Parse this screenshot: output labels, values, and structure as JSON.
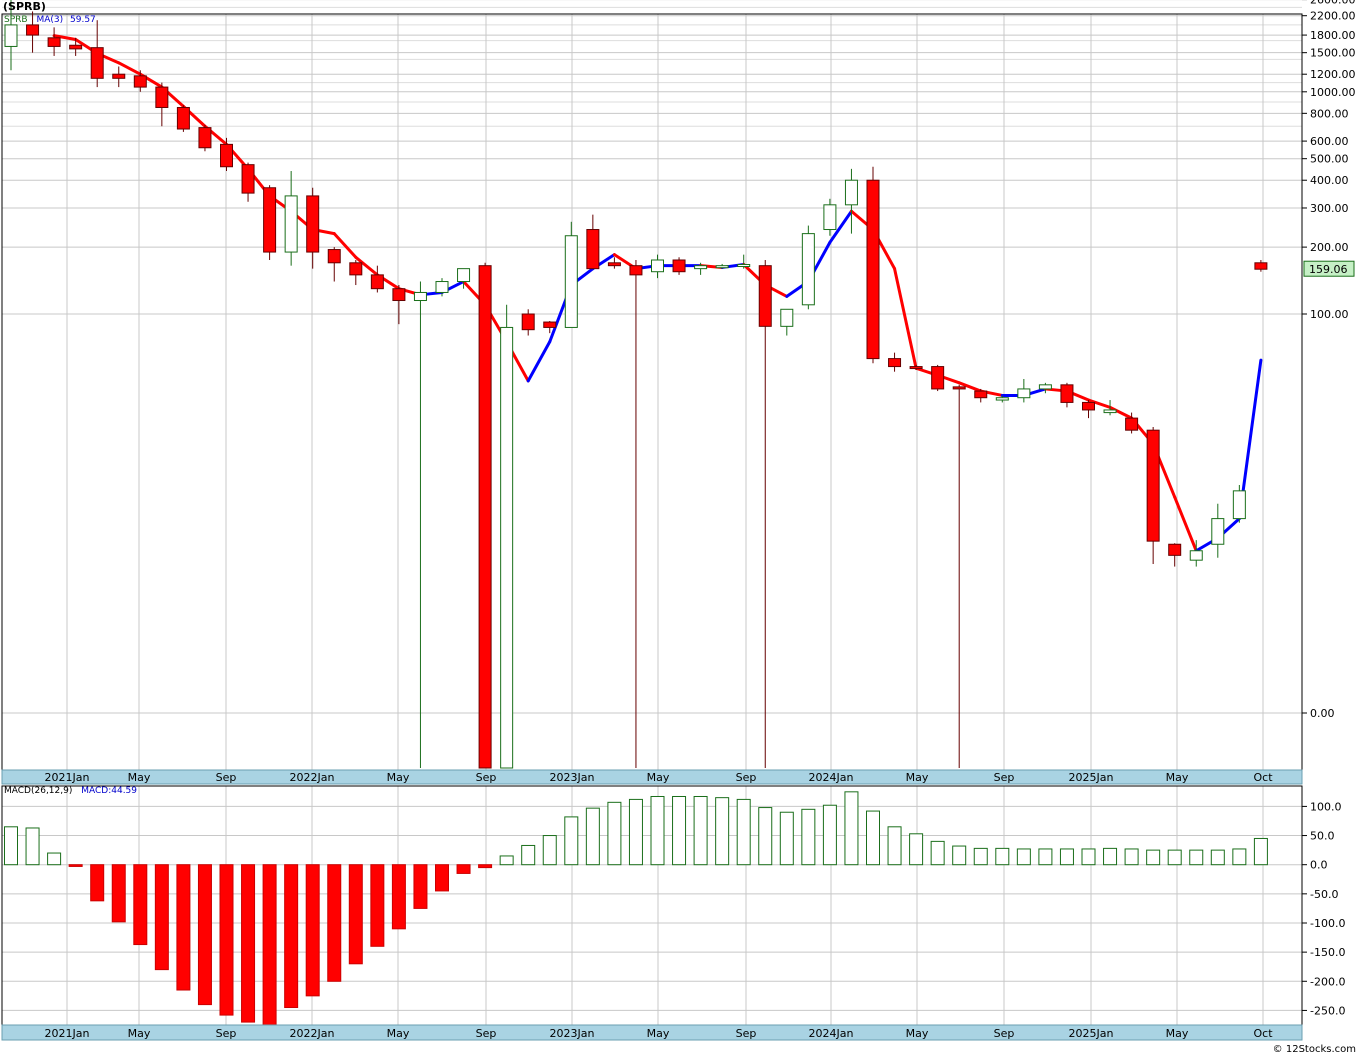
{
  "ticker_label": "(SPRB)",
  "price_legend": {
    "symbol": "SPRB",
    "ma_label": "MA(3)",
    "ma_value": "59.57"
  },
  "macd_legend": {
    "label": "MACD(26,12,9)",
    "macd_label": "MACD:44.59"
  },
  "last_price_label": "159.06",
  "credit": "© 12Stocks.com",
  "colors": {
    "up": "#1a6e1a",
    "down": "#ff0000",
    "ma_up": "#0000ff",
    "ma_down": "#ff0000",
    "axis_band": "#a9d3e3",
    "grid": "#c8c8c8"
  },
  "x_labels": [
    "2021Jan",
    "May",
    "Sep",
    "2022Jan",
    "May",
    "Sep",
    "2023Jan",
    "May",
    "Sep",
    "2024Jan",
    "May",
    "Sep",
    "2025Jan",
    "May",
    "Oct"
  ],
  "chart_data": [
    {
      "type": "candlestick",
      "scale": "log",
      "price_ticks": [
        "2600.00",
        "2200.00",
        "1800.00",
        "1500.00",
        "1200.00",
        "1000.00",
        "800.00",
        "600.00",
        "500.00",
        "400.00",
        "300.00",
        "200.00",
        "159.06",
        "100.00",
        "0.00"
      ],
      "candles": [
        {
          "m": "2020-11",
          "o": 1600,
          "h": 2600,
          "l": 1250,
          "c": 2000,
          "ma": null
        },
        {
          "m": "2020-12",
          "o": 2000,
          "h": 2300,
          "l": 1500,
          "c": 1800,
          "ma": null
        },
        {
          "m": "2021-01",
          "o": 1750,
          "h": 1950,
          "l": 1450,
          "c": 1600,
          "ma": 1790
        },
        {
          "m": "2021-02",
          "o": 1620,
          "h": 1750,
          "l": 1450,
          "c": 1560,
          "ma": 1720
        },
        {
          "m": "2021-03",
          "o": 1580,
          "h": 2100,
          "l": 1050,
          "c": 1150,
          "ma": 1490
        },
        {
          "m": "2021-04",
          "o": 1200,
          "h": 1300,
          "l": 1050,
          "c": 1150,
          "ma": 1350
        },
        {
          "m": "2021-05",
          "o": 1180,
          "h": 1250,
          "l": 1000,
          "c": 1050,
          "ma": 1200
        },
        {
          "m": "2021-06",
          "o": 1050,
          "h": 1100,
          "l": 700,
          "c": 850,
          "ma": 1050
        },
        {
          "m": "2021-07",
          "o": 850,
          "h": 870,
          "l": 660,
          "c": 680,
          "ma": 860
        },
        {
          "m": "2021-08",
          "o": 690,
          "h": 710,
          "l": 540,
          "c": 560,
          "ma": 700
        },
        {
          "m": "2021-09",
          "o": 580,
          "h": 620,
          "l": 440,
          "c": 460,
          "ma": 580
        },
        {
          "m": "2021-10",
          "o": 470,
          "h": 480,
          "l": 320,
          "c": 350,
          "ma": 450
        },
        {
          "m": "2021-11",
          "o": 370,
          "h": 380,
          "l": 175,
          "c": 190,
          "ma": 340
        },
        {
          "m": "2021-12",
          "o": 190,
          "h": 440,
          "l": 165,
          "c": 340,
          "ma": 290
        },
        {
          "m": "2022-01",
          "o": 340,
          "h": 370,
          "l": 160,
          "c": 190,
          "ma": 240
        },
        {
          "m": "2022-02",
          "o": 195,
          "h": 200,
          "l": 140,
          "c": 170,
          "ma": 230
        },
        {
          "m": "2022-03",
          "o": 170,
          "h": 175,
          "l": 135,
          "c": 150,
          "ma": 180
        },
        {
          "m": "2022-04",
          "o": 150,
          "h": 165,
          "l": 125,
          "c": 130,
          "ma": 150
        },
        {
          "m": "2022-05",
          "o": 130,
          "h": 135,
          "l": 90,
          "c": 115,
          "ma": 130
        },
        {
          "m": "2022-06",
          "o": 115,
          "h": 140,
          "l": 0.08,
          "c": 125,
          "ma": 122
        },
        {
          "m": "2022-07",
          "o": 125,
          "h": 145,
          "l": 120,
          "c": 140,
          "ma": 125
        },
        {
          "m": "2022-08",
          "o": 140,
          "h": 160,
          "l": 130,
          "c": 160,
          "ma": 140
        },
        {
          "m": "2022-09",
          "o": 165,
          "h": 170,
          "l": 0.07,
          "c": 0.07,
          "ma": 110
        },
        {
          "m": "2022-10",
          "o": 0.07,
          "h": 110,
          "l": 0.07,
          "c": 87,
          "ma": 75
        },
        {
          "m": "2022-11",
          "o": 100,
          "h": 105,
          "l": 80,
          "c": 85,
          "ma": 50
        },
        {
          "m": "2022-12",
          "o": 92,
          "h": 93,
          "l": 82,
          "c": 87,
          "ma": 75
        },
        {
          "m": "2023-01",
          "o": 87,
          "h": 260,
          "l": 87,
          "c": 225,
          "ma": 135
        },
        {
          "m": "2023-02",
          "o": 240,
          "h": 280,
          "l": 160,
          "c": 160,
          "ma": 160
        },
        {
          "m": "2023-03",
          "o": 170,
          "h": 180,
          "l": 160,
          "c": 165,
          "ma": 185
        },
        {
          "m": "2023-04",
          "o": 165,
          "h": 175,
          "l": 0.25,
          "c": 150,
          "ma": 160
        },
        {
          "m": "2023-05",
          "o": 155,
          "h": 185,
          "l": 145,
          "c": 175,
          "ma": 165
        },
        {
          "m": "2023-06",
          "o": 175,
          "h": 180,
          "l": 150,
          "c": 155,
          "ma": 165
        },
        {
          "m": "2023-07",
          "o": 160,
          "h": 170,
          "l": 150,
          "c": 165,
          "ma": 165
        },
        {
          "m": "2023-08",
          "o": 165,
          "h": 168,
          "l": 160,
          "c": 165,
          "ma": 162
        },
        {
          "m": "2023-09",
          "o": 165,
          "h": 185,
          "l": 160,
          "c": 167,
          "ma": 167
        },
        {
          "m": "2023-10",
          "o": 165,
          "h": 175,
          "l": 0.08,
          "c": 88,
          "ma": 135
        },
        {
          "m": "2023-11",
          "o": 88,
          "h": 105,
          "l": 80,
          "c": 105,
          "ma": 120
        },
        {
          "m": "2023-12",
          "o": 110,
          "h": 250,
          "l": 105,
          "c": 230,
          "ma": 140
        },
        {
          "m": "2024-01",
          "o": 240,
          "h": 330,
          "l": 225,
          "c": 310,
          "ma": 210
        },
        {
          "m": "2024-02",
          "o": 310,
          "h": 450,
          "l": 230,
          "c": 400,
          "ma": 290
        },
        {
          "m": "2024-03",
          "o": 400,
          "h": 460,
          "l": 60,
          "c": 63,
          "ma": 240
        },
        {
          "m": "2024-04",
          "o": 63,
          "h": 67,
          "l": 55,
          "c": 58,
          "ma": 160
        },
        {
          "m": "2024-05",
          "o": 58,
          "h": 59,
          "l": 56,
          "c": 57,
          "ma": 57
        },
        {
          "m": "2024-06",
          "o": 58,
          "h": 59,
          "l": 45,
          "c": 46,
          "ma": 53
        },
        {
          "m": "2024-07",
          "o": 47,
          "h": 48,
          "l": 0.03,
          "c": 46,
          "ma": 49
        },
        {
          "m": "2024-08",
          "o": 45,
          "h": 46,
          "l": 40,
          "c": 42,
          "ma": 45
        },
        {
          "m": "2024-09",
          "o": 41,
          "h": 43,
          "l": 40,
          "c": 42,
          "ma": 43
        },
        {
          "m": "2024-10",
          "o": 42,
          "h": 51,
          "l": 40,
          "c": 46,
          "ma": 43
        },
        {
          "m": "2024-11",
          "o": 46,
          "h": 49,
          "l": 44,
          "c": 48,
          "ma": 46
        },
        {
          "m": "2024-12",
          "o": 48,
          "h": 49,
          "l": 38,
          "c": 40,
          "ma": 45
        },
        {
          "m": "2025-01",
          "o": 40,
          "h": 41,
          "l": 34,
          "c": 37,
          "ma": 41
        },
        {
          "m": "2025-02",
          "o": 36,
          "h": 41,
          "l": 35,
          "c": 37,
          "ma": 38
        },
        {
          "m": "2025-03",
          "o": 34,
          "h": 36,
          "l": 29,
          "c": 30,
          "ma": 34
        },
        {
          "m": "2025-04",
          "o": 30,
          "h": 31,
          "l": 7.5,
          "c": 9.5,
          "ma": 26
        },
        {
          "m": "2025-05",
          "o": 9.2,
          "h": 9.3,
          "l": 7.3,
          "c": 8.2,
          "ma": 15
        },
        {
          "m": "2025-06",
          "o": 7.8,
          "h": 9.6,
          "l": 7.3,
          "c": 8.6,
          "ma": 8.6
        },
        {
          "m": "2025-07",
          "o": 9.2,
          "h": 14,
          "l": 8.0,
          "c": 12,
          "ma": 9.8
        },
        {
          "m": "2025-08",
          "o": 12,
          "h": 17,
          "l": 11.5,
          "c": 16,
          "ma": 12
        },
        {
          "m": "2025-09",
          "o": 170,
          "h": 175,
          "l": 155,
          "c": 159.06,
          "ma": 62
        }
      ]
    },
    {
      "type": "bar",
      "title": "MACD(26,12,9)",
      "y_ticks": [
        "100.0",
        "50.0",
        "0.0",
        "-50.0",
        "-100.0",
        "-150.0",
        "-200.0",
        "-250.0"
      ],
      "ylim": [
        -275,
        135
      ],
      "values": [
        65,
        63,
        20,
        -3,
        -62,
        -98,
        -137,
        -180,
        -215,
        -240,
        -258,
        -270,
        -278,
        -245,
        -225,
        -200,
        -170,
        -140,
        -110,
        -75,
        -45,
        -15,
        -5,
        15,
        33,
        50,
        82,
        97,
        107,
        112,
        117,
        117,
        117,
        115,
        112,
        98,
        90,
        95,
        102,
        125,
        92,
        65,
        53,
        40,
        32,
        28,
        28,
        27,
        27,
        27,
        27,
        28,
        27,
        25,
        25,
        25,
        25,
        27,
        45
      ]
    }
  ]
}
